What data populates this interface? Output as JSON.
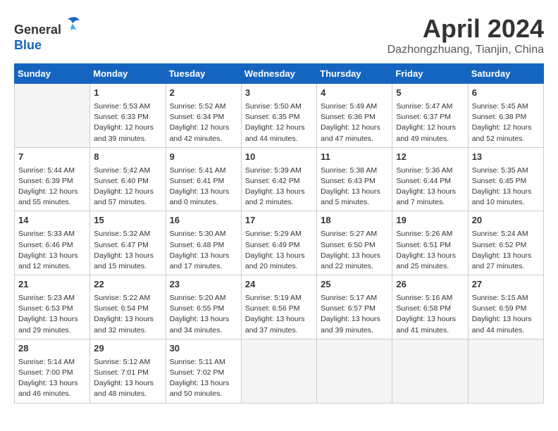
{
  "header": {
    "logo_line1": "General",
    "logo_line2": "Blue",
    "month_title": "April 2024",
    "location": "Dazhongzhuang, Tianjin, China"
  },
  "days_of_week": [
    "Sunday",
    "Monday",
    "Tuesday",
    "Wednesday",
    "Thursday",
    "Friday",
    "Saturday"
  ],
  "weeks": [
    [
      {
        "day": null
      },
      {
        "day": "1",
        "sunrise": "5:53 AM",
        "sunset": "6:33 PM",
        "daylight": "12 hours and 39 minutes."
      },
      {
        "day": "2",
        "sunrise": "5:52 AM",
        "sunset": "6:34 PM",
        "daylight": "12 hours and 42 minutes."
      },
      {
        "day": "3",
        "sunrise": "5:50 AM",
        "sunset": "6:35 PM",
        "daylight": "12 hours and 44 minutes."
      },
      {
        "day": "4",
        "sunrise": "5:49 AM",
        "sunset": "6:36 PM",
        "daylight": "12 hours and 47 minutes."
      },
      {
        "day": "5",
        "sunrise": "5:47 AM",
        "sunset": "6:37 PM",
        "daylight": "12 hours and 49 minutes."
      },
      {
        "day": "6",
        "sunrise": "5:45 AM",
        "sunset": "6:38 PM",
        "daylight": "12 hours and 52 minutes."
      }
    ],
    [
      {
        "day": "7",
        "sunrise": "5:44 AM",
        "sunset": "6:39 PM",
        "daylight": "12 hours and 55 minutes."
      },
      {
        "day": "8",
        "sunrise": "5:42 AM",
        "sunset": "6:40 PM",
        "daylight": "12 hours and 57 minutes."
      },
      {
        "day": "9",
        "sunrise": "5:41 AM",
        "sunset": "6:41 PM",
        "daylight": "13 hours and 0 minutes."
      },
      {
        "day": "10",
        "sunrise": "5:39 AM",
        "sunset": "6:42 PM",
        "daylight": "13 hours and 2 minutes."
      },
      {
        "day": "11",
        "sunrise": "5:38 AM",
        "sunset": "6:43 PM",
        "daylight": "13 hours and 5 minutes."
      },
      {
        "day": "12",
        "sunrise": "5:36 AM",
        "sunset": "6:44 PM",
        "daylight": "13 hours and 7 minutes."
      },
      {
        "day": "13",
        "sunrise": "5:35 AM",
        "sunset": "6:45 PM",
        "daylight": "13 hours and 10 minutes."
      }
    ],
    [
      {
        "day": "14",
        "sunrise": "5:33 AM",
        "sunset": "6:46 PM",
        "daylight": "13 hours and 12 minutes."
      },
      {
        "day": "15",
        "sunrise": "5:32 AM",
        "sunset": "6:47 PM",
        "daylight": "13 hours and 15 minutes."
      },
      {
        "day": "16",
        "sunrise": "5:30 AM",
        "sunset": "6:48 PM",
        "daylight": "13 hours and 17 minutes."
      },
      {
        "day": "17",
        "sunrise": "5:29 AM",
        "sunset": "6:49 PM",
        "daylight": "13 hours and 20 minutes."
      },
      {
        "day": "18",
        "sunrise": "5:27 AM",
        "sunset": "6:50 PM",
        "daylight": "13 hours and 22 minutes."
      },
      {
        "day": "19",
        "sunrise": "5:26 AM",
        "sunset": "6:51 PM",
        "daylight": "13 hours and 25 minutes."
      },
      {
        "day": "20",
        "sunrise": "5:24 AM",
        "sunset": "6:52 PM",
        "daylight": "13 hours and 27 minutes."
      }
    ],
    [
      {
        "day": "21",
        "sunrise": "5:23 AM",
        "sunset": "6:53 PM",
        "daylight": "13 hours and 29 minutes."
      },
      {
        "day": "22",
        "sunrise": "5:22 AM",
        "sunset": "6:54 PM",
        "daylight": "13 hours and 32 minutes."
      },
      {
        "day": "23",
        "sunrise": "5:20 AM",
        "sunset": "6:55 PM",
        "daylight": "13 hours and 34 minutes."
      },
      {
        "day": "24",
        "sunrise": "5:19 AM",
        "sunset": "6:56 PM",
        "daylight": "13 hours and 37 minutes."
      },
      {
        "day": "25",
        "sunrise": "5:17 AM",
        "sunset": "6:57 PM",
        "daylight": "13 hours and 39 minutes."
      },
      {
        "day": "26",
        "sunrise": "5:16 AM",
        "sunset": "6:58 PM",
        "daylight": "13 hours and 41 minutes."
      },
      {
        "day": "27",
        "sunrise": "5:15 AM",
        "sunset": "6:59 PM",
        "daylight": "13 hours and 44 minutes."
      }
    ],
    [
      {
        "day": "28",
        "sunrise": "5:14 AM",
        "sunset": "7:00 PM",
        "daylight": "13 hours and 46 minutes."
      },
      {
        "day": "29",
        "sunrise": "5:12 AM",
        "sunset": "7:01 PM",
        "daylight": "13 hours and 48 minutes."
      },
      {
        "day": "30",
        "sunrise": "5:11 AM",
        "sunset": "7:02 PM",
        "daylight": "13 hours and 50 minutes."
      },
      {
        "day": null
      },
      {
        "day": null
      },
      {
        "day": null
      },
      {
        "day": null
      }
    ]
  ],
  "labels": {
    "sunrise_label": "Sunrise:",
    "sunset_label": "Sunset:",
    "daylight_label": "Daylight:"
  }
}
